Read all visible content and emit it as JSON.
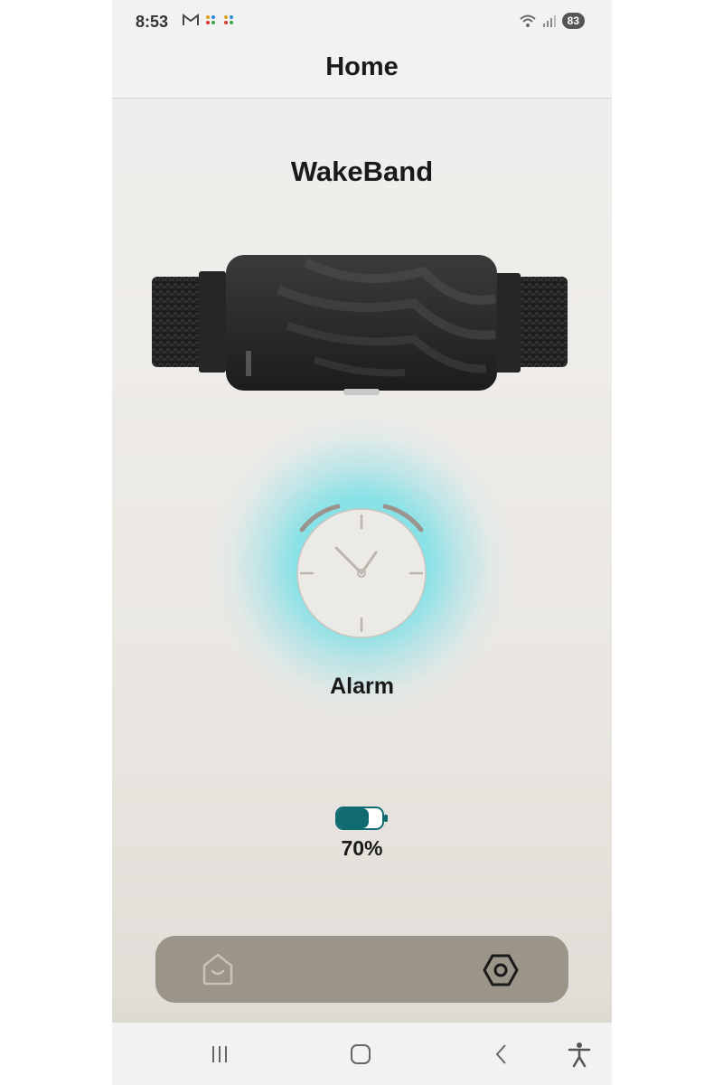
{
  "status_bar": {
    "time": "8:53",
    "notification_icons": [
      "gmail-icon",
      "app-icon",
      "app-icon"
    ],
    "battery_level": "83",
    "indicators": [
      "wifi-icon",
      "signal-icon"
    ]
  },
  "header": {
    "title": "Home"
  },
  "device": {
    "name": "WakeBand",
    "image": "wristband-image"
  },
  "alarm": {
    "label": "Alarm",
    "icon": "clock-icon",
    "glow_color": "#8fe0e6"
  },
  "battery": {
    "percent_text": "70%",
    "level": 0.7,
    "color": "#0f6b6f"
  },
  "tab_bar": {
    "items": [
      {
        "name": "home",
        "icon": "home-icon"
      },
      {
        "name": "settings",
        "icon": "hexagon-settings-icon"
      }
    ],
    "color": "#9b9488"
  },
  "system_nav": [
    "recent-apps-icon",
    "home-button-icon",
    "back-icon",
    "accessibility-icon"
  ]
}
